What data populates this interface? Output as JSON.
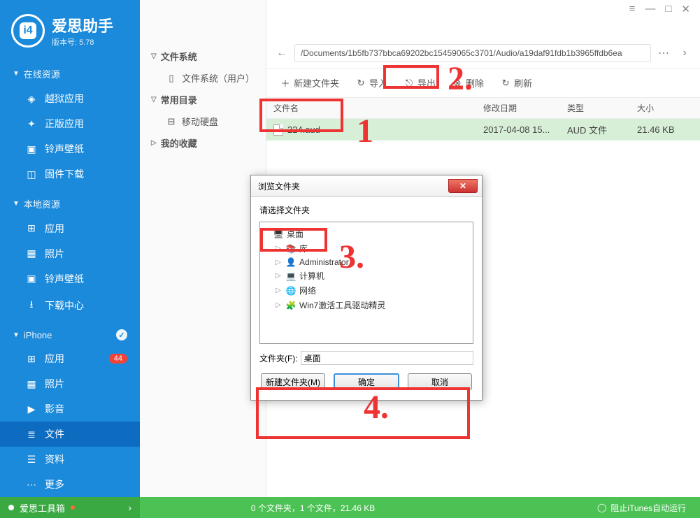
{
  "app": {
    "title": "爱思助手",
    "version_prefix": "版本号: ",
    "version": "5.78"
  },
  "titlebar": {
    "menu": "≡",
    "min": "—",
    "max": "□",
    "close": "✕"
  },
  "sidebar": {
    "sections": [
      {
        "title": "在线资源",
        "items": [
          {
            "label": "越狱应用",
            "icon": "cube"
          },
          {
            "label": "正版应用",
            "icon": "puzzle"
          },
          {
            "label": "铃声壁纸",
            "icon": "media"
          },
          {
            "label": "固件下载",
            "icon": "box"
          }
        ]
      },
      {
        "title": "本地资源",
        "items": [
          {
            "label": "应用",
            "icon": "grid"
          },
          {
            "label": "照片",
            "icon": "photo"
          },
          {
            "label": "铃声壁纸",
            "icon": "media"
          },
          {
            "label": "下载中心",
            "icon": "download"
          }
        ]
      },
      {
        "title": "iPhone",
        "check": true,
        "items": [
          {
            "label": "应用",
            "icon": "grid",
            "badge": "44"
          },
          {
            "label": "照片",
            "icon": "photo"
          },
          {
            "label": "影音",
            "icon": "video"
          },
          {
            "label": "文件",
            "icon": "file",
            "active": true
          },
          {
            "label": "资料",
            "icon": "list"
          },
          {
            "label": "更多",
            "icon": "more"
          }
        ]
      }
    ]
  },
  "midpanel": {
    "s1": {
      "title": "文件系统",
      "item": "文件系统（用户）"
    },
    "s2": {
      "title": "常用目录",
      "item": "移动硬盘"
    },
    "s3": {
      "title": "我的收藏"
    }
  },
  "path": {
    "value": "/Documents/1b5fb737bbca69202bc15459065c3701/Audio/a19daf91fdb1b3965ffdb6ea"
  },
  "toolbar": {
    "new_folder": "新建文件夹",
    "import": "导入",
    "export": "导出",
    "delete": "删除",
    "refresh": "刷新"
  },
  "table": {
    "head": {
      "name": "文件名",
      "date": "修改日期",
      "type": "类型",
      "size": "大小"
    },
    "row": {
      "name": "224.aud",
      "date": "2017-04-08 15...",
      "type": "AUD 文件",
      "size": "21.46 KB"
    }
  },
  "dialog": {
    "title": "浏览文件夹",
    "prompt": "请选择文件夹",
    "tree": {
      "root": "桌面",
      "lib": "库",
      "admin": "Administrator",
      "computer": "计算机",
      "network": "网络",
      "win7": "Win7激活工具驱动精灵"
    },
    "folder_label": "文件夹(F):",
    "folder_value": "桌面",
    "new_folder": "新建文件夹(M)",
    "ok": "确定",
    "cancel": "取消"
  },
  "footer": {
    "toolbox": "爱思工具箱",
    "status": "0 个文件夹，1 个文件，21.46 KB",
    "itunes": "阻止iTunes自动运行"
  },
  "ann": {
    "n1": "1",
    "n2": "2.",
    "n3": "3.",
    "n4": "4."
  }
}
